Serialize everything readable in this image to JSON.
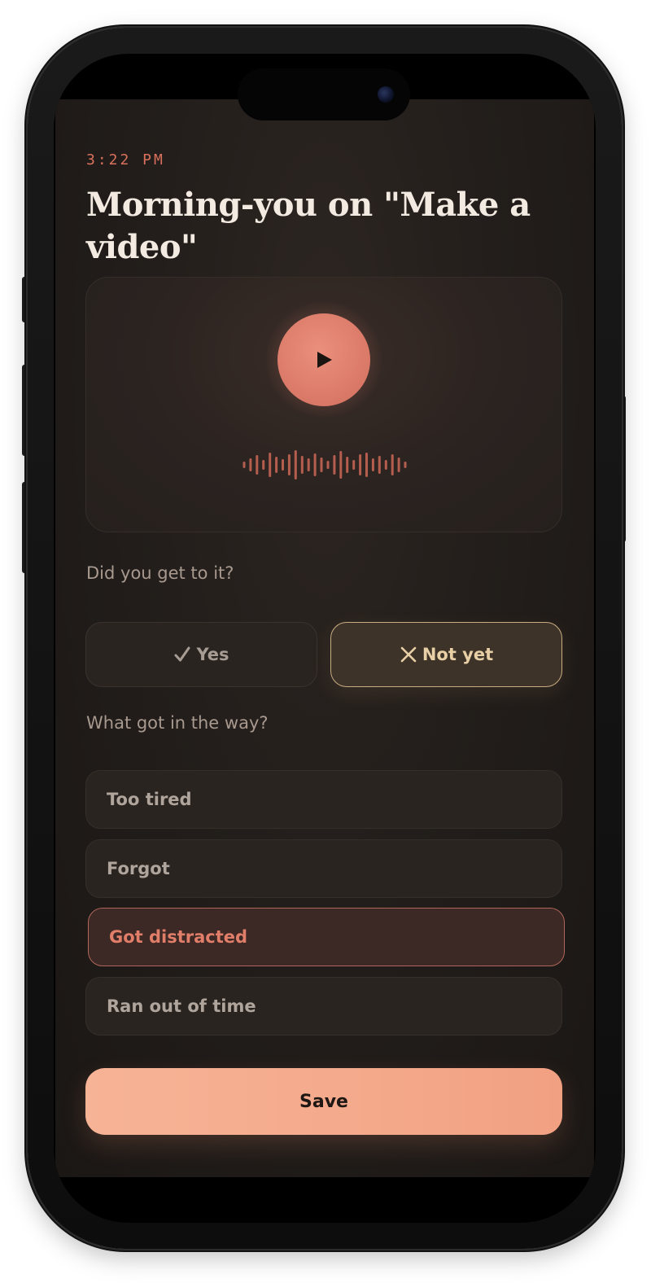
{
  "status": {
    "time": "3:22 PM"
  },
  "header": {
    "title": "Morning-you on \"Make a video\""
  },
  "player": {
    "play_icon": "play-icon",
    "waveform_icon": "waveform",
    "accent_color": "#dc7b69"
  },
  "question_done": {
    "label": "Did you get to it?",
    "options": [
      {
        "icon": "checkmark-icon",
        "label": "Yes",
        "selected": false
      },
      {
        "icon": "x-icon",
        "label": "Not yet",
        "selected": true
      }
    ]
  },
  "question_reason": {
    "label": "What got in the way?",
    "options": [
      {
        "label": "Too tired",
        "selected": false
      },
      {
        "label": "Forgot",
        "selected": false
      },
      {
        "label": "Got distracted",
        "selected": true
      },
      {
        "label": "Ran out of time",
        "selected": false
      }
    ]
  },
  "actions": {
    "save_label": "Save"
  },
  "colors": {
    "background": "#231e1b",
    "accent": "#dc7b69",
    "highlight_gold": "#c9ad82",
    "save_gradient_start": "#f7b396",
    "save_gradient_end": "#f2a082"
  }
}
